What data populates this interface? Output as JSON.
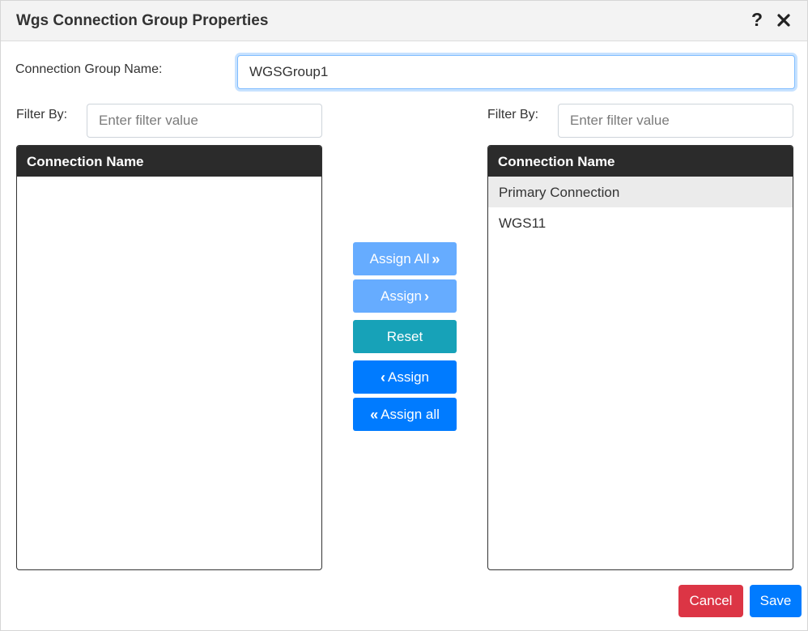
{
  "dialog": {
    "title": "Wgs Connection Group Properties",
    "help_icon": "question-mark-icon",
    "close_icon": "close-icon"
  },
  "group_name": {
    "label": "Connection Group Name:",
    "value": "WGSGroup1"
  },
  "left_panel": {
    "filter_label": "Filter By:",
    "filter_placeholder": "Enter filter value",
    "header": "Connection Name",
    "items": []
  },
  "right_panel": {
    "filter_label": "Filter By:",
    "filter_placeholder": "Enter filter value",
    "header": "Connection Name",
    "items": [
      {
        "label": "Primary Connection",
        "selected": true
      },
      {
        "label": "WGS11",
        "selected": false
      }
    ]
  },
  "actions": {
    "assign_all": "Assign All",
    "assign": "Assign",
    "reset": "Reset",
    "unassign": "Assign",
    "unassign_all": "Assign all"
  },
  "footer": {
    "cancel": "Cancel",
    "save": "Save"
  },
  "colors": {
    "primary": "#007bff",
    "primary_light": "#66acff",
    "reset": "#17a2b8",
    "danger": "#dc3545",
    "header_dark": "#2b2b2b"
  }
}
